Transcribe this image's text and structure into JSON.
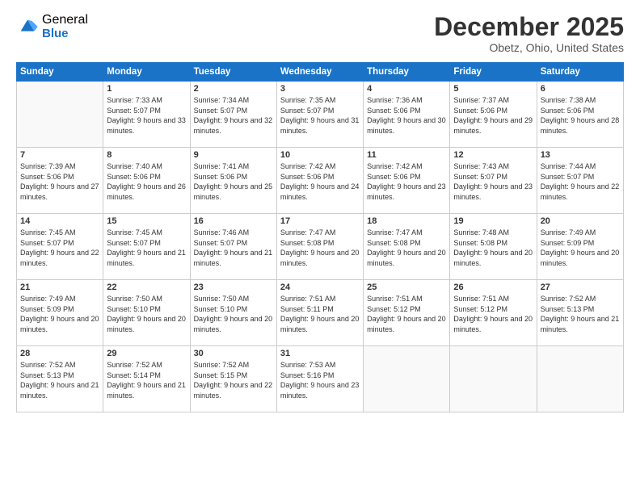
{
  "logo": {
    "general": "General",
    "blue": "Blue"
  },
  "title": "December 2025",
  "subtitle": "Obetz, Ohio, United States",
  "weekdays": [
    "Sunday",
    "Monday",
    "Tuesday",
    "Wednesday",
    "Thursday",
    "Friday",
    "Saturday"
  ],
  "weeks": [
    [
      {
        "day": "",
        "empty": true
      },
      {
        "day": "1",
        "sunrise": "7:33 AM",
        "sunset": "5:07 PM",
        "daylight": "9 hours and 33 minutes."
      },
      {
        "day": "2",
        "sunrise": "7:34 AM",
        "sunset": "5:07 PM",
        "daylight": "9 hours and 32 minutes."
      },
      {
        "day": "3",
        "sunrise": "7:35 AM",
        "sunset": "5:07 PM",
        "daylight": "9 hours and 31 minutes."
      },
      {
        "day": "4",
        "sunrise": "7:36 AM",
        "sunset": "5:06 PM",
        "daylight": "9 hours and 30 minutes."
      },
      {
        "day": "5",
        "sunrise": "7:37 AM",
        "sunset": "5:06 PM",
        "daylight": "9 hours and 29 minutes."
      },
      {
        "day": "6",
        "sunrise": "7:38 AM",
        "sunset": "5:06 PM",
        "daylight": "9 hours and 28 minutes."
      }
    ],
    [
      {
        "day": "7",
        "sunrise": "7:39 AM",
        "sunset": "5:06 PM",
        "daylight": "9 hours and 27 minutes."
      },
      {
        "day": "8",
        "sunrise": "7:40 AM",
        "sunset": "5:06 PM",
        "daylight": "9 hours and 26 minutes."
      },
      {
        "day": "9",
        "sunrise": "7:41 AM",
        "sunset": "5:06 PM",
        "daylight": "9 hours and 25 minutes."
      },
      {
        "day": "10",
        "sunrise": "7:42 AM",
        "sunset": "5:06 PM",
        "daylight": "9 hours and 24 minutes."
      },
      {
        "day": "11",
        "sunrise": "7:42 AM",
        "sunset": "5:06 PM",
        "daylight": "9 hours and 23 minutes."
      },
      {
        "day": "12",
        "sunrise": "7:43 AM",
        "sunset": "5:07 PM",
        "daylight": "9 hours and 23 minutes."
      },
      {
        "day": "13",
        "sunrise": "7:44 AM",
        "sunset": "5:07 PM",
        "daylight": "9 hours and 22 minutes."
      }
    ],
    [
      {
        "day": "14",
        "sunrise": "7:45 AM",
        "sunset": "5:07 PM",
        "daylight": "9 hours and 22 minutes."
      },
      {
        "day": "15",
        "sunrise": "7:45 AM",
        "sunset": "5:07 PM",
        "daylight": "9 hours and 21 minutes."
      },
      {
        "day": "16",
        "sunrise": "7:46 AM",
        "sunset": "5:07 PM",
        "daylight": "9 hours and 21 minutes."
      },
      {
        "day": "17",
        "sunrise": "7:47 AM",
        "sunset": "5:08 PM",
        "daylight": "9 hours and 20 minutes."
      },
      {
        "day": "18",
        "sunrise": "7:47 AM",
        "sunset": "5:08 PM",
        "daylight": "9 hours and 20 minutes."
      },
      {
        "day": "19",
        "sunrise": "7:48 AM",
        "sunset": "5:08 PM",
        "daylight": "9 hours and 20 minutes."
      },
      {
        "day": "20",
        "sunrise": "7:49 AM",
        "sunset": "5:09 PM",
        "daylight": "9 hours and 20 minutes."
      }
    ],
    [
      {
        "day": "21",
        "sunrise": "7:49 AM",
        "sunset": "5:09 PM",
        "daylight": "9 hours and 20 minutes."
      },
      {
        "day": "22",
        "sunrise": "7:50 AM",
        "sunset": "5:10 PM",
        "daylight": "9 hours and 20 minutes."
      },
      {
        "day": "23",
        "sunrise": "7:50 AM",
        "sunset": "5:10 PM",
        "daylight": "9 hours and 20 minutes."
      },
      {
        "day": "24",
        "sunrise": "7:51 AM",
        "sunset": "5:11 PM",
        "daylight": "9 hours and 20 minutes."
      },
      {
        "day": "25",
        "sunrise": "7:51 AM",
        "sunset": "5:12 PM",
        "daylight": "9 hours and 20 minutes."
      },
      {
        "day": "26",
        "sunrise": "7:51 AM",
        "sunset": "5:12 PM",
        "daylight": "9 hours and 20 minutes."
      },
      {
        "day": "27",
        "sunrise": "7:52 AM",
        "sunset": "5:13 PM",
        "daylight": "9 hours and 21 minutes."
      }
    ],
    [
      {
        "day": "28",
        "sunrise": "7:52 AM",
        "sunset": "5:13 PM",
        "daylight": "9 hours and 21 minutes."
      },
      {
        "day": "29",
        "sunrise": "7:52 AM",
        "sunset": "5:14 PM",
        "daylight": "9 hours and 21 minutes."
      },
      {
        "day": "30",
        "sunrise": "7:52 AM",
        "sunset": "5:15 PM",
        "daylight": "9 hours and 22 minutes."
      },
      {
        "day": "31",
        "sunrise": "7:53 AM",
        "sunset": "5:16 PM",
        "daylight": "9 hours and 23 minutes."
      },
      {
        "day": "",
        "empty": true
      },
      {
        "day": "",
        "empty": true
      },
      {
        "day": "",
        "empty": true
      }
    ]
  ]
}
